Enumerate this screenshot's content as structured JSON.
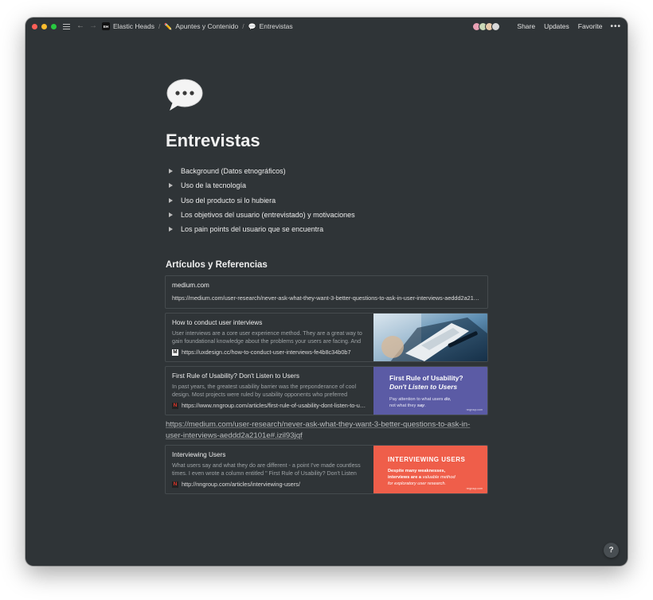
{
  "topbar": {
    "workspace_badge": "EH",
    "breadcrumbs": [
      {
        "icon": "workspace-badge",
        "label": "Elastic Heads"
      },
      {
        "icon": "✏️",
        "label": "Apuntes y Contenido"
      },
      {
        "icon": "💬",
        "label": "Entrevistas"
      }
    ],
    "actions": {
      "share": "Share",
      "updates": "Updates",
      "favorite": "Favorite",
      "more": "•••"
    }
  },
  "page": {
    "icon": "speech-bubble-icon",
    "title": "Entrevistas",
    "toggles": [
      "Background (Datos etnográficos)",
      "Uso de la tecnología",
      "Uso del producto si lo hubiera",
      "Los objetivos del usuario (entrevistado) y motivaciones",
      "Los pain points del usuario que se encuentra"
    ],
    "section_heading": "Artículos y Referencias",
    "bookmarks": [
      {
        "title": "medium.com",
        "url": "https://medium.com/user-research/never-ask-what-they-want-3-better-questions-to-ask-in-user-interviews-aeddd2a2101e#.izil93jqf"
      },
      {
        "title": "How to conduct user interviews",
        "description": "User interviews are a core user experience method. They are a great way to gain foundational knowledge about the problems your users are facing. And",
        "favicon": "M",
        "url": "https://uxdesign.cc/how-to-conduct-user-interviews-fe4b8c34b0b7"
      },
      {
        "title": "First Rule of Usability? Don't Listen to Users",
        "description": "In past years, the greatest usability barrier was the preponderance of cool design. Most projects were ruled by usability opponents who preferred",
        "favicon": "N",
        "url": "https://www.nngroup.com/articles/first-rule-of-usability-dont-listen-to-users/",
        "thumb": {
          "line1": "First Rule of Usability?",
          "line2": "Don't Listen to Users",
          "sub1_pre": "Pay attention to what users ",
          "sub1_em": "do",
          "sub1_post": ",",
          "sub2_pre": "not what they ",
          "sub2_em": "say",
          "sub2_post": ".",
          "footer": "nngroup.com"
        }
      },
      {
        "title": "Interviewing Users",
        "description": "What users say and what they do are different - a point I've made countless times. I even wrote a column entitled \" First Rule of Usability? Don't Listen",
        "favicon": "N",
        "url": "http://nngroup.com/articles/interviewing-users/",
        "thumb": {
          "heading": "INTERVIEWING USERS",
          "line1": "Despite many weaknesses,",
          "line2_pre": "interviews are a ",
          "line2_em": "valuable method",
          "line3": "for exploratory user research.",
          "footer": "nngroup.com"
        }
      }
    ],
    "plain_link": "https://medium.com/user-research/never-ask-what-they-want-3-better-questions-to-ask-in-user-interviews-aeddd2a2101e#.izil93jqf"
  },
  "help": "?",
  "colors": {
    "background": "#2f3437",
    "nng_purple": "#5b5ba5",
    "nng_orange": "#ef5e4a",
    "traffic_red": "#fe5f57",
    "traffic_yellow": "#febc2e",
    "traffic_green": "#28c840"
  }
}
